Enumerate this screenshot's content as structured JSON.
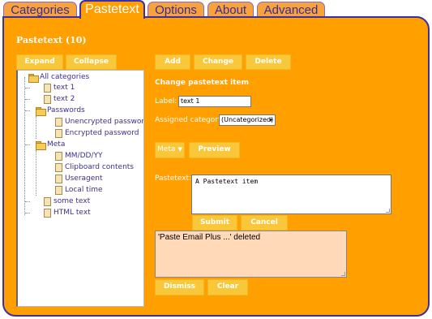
{
  "tabs": [
    {
      "label": "Categories",
      "active": false
    },
    {
      "label": "Pastetext",
      "active": true
    },
    {
      "label": "Options",
      "active": false
    },
    {
      "label": "About",
      "active": false
    },
    {
      "label": "Advanced",
      "active": false
    }
  ],
  "page_title": "Pastetext (10)",
  "tree_buttons": {
    "expand": "Expand",
    "collapse": "Collapse"
  },
  "tree": {
    "root": "All categories",
    "items": [
      {
        "label": "text 1",
        "type": "doc"
      },
      {
        "label": "text 2",
        "type": "doc"
      },
      {
        "label": "Passwords",
        "type": "folder"
      },
      {
        "label": "Unencrypted password",
        "type": "doc"
      },
      {
        "label": "Encrypted password",
        "type": "doc"
      },
      {
        "label": "Meta",
        "type": "folder"
      },
      {
        "label": "MM/DD/YY",
        "type": "doc"
      },
      {
        "label": "Clipboard contents",
        "type": "doc"
      },
      {
        "label": "Useragent",
        "type": "doc"
      },
      {
        "label": "Local time",
        "type": "doc"
      },
      {
        "label": "some text",
        "type": "doc"
      },
      {
        "label": "HTML text",
        "type": "doc"
      }
    ]
  },
  "actions": {
    "add": "Add",
    "change": "Change",
    "delete": "Delete"
  },
  "form": {
    "heading": "Change pastetext item",
    "label_caption": "Label:",
    "label_value": "text 1",
    "category_caption": "Assigned category",
    "category_value": "(Uncategorized)",
    "meta_label": "Meta",
    "preview_label": "Preview",
    "pastetext_caption": "Pastetext:",
    "pastetext_value": "A Pastetext item",
    "submit_label": "Submit",
    "cancel_label": "Cancel"
  },
  "log": {
    "message": "'Paste Email Plus ...' deleted",
    "dismiss_label": "Dismiss",
    "clear_label": "Clear"
  },
  "colors": {
    "panel": "#ff9f00",
    "button": "#f9c83a",
    "tab_border": "#3b2fa5",
    "tree_text": "#3a2f96",
    "log_bg": "#ffd9b8"
  }
}
